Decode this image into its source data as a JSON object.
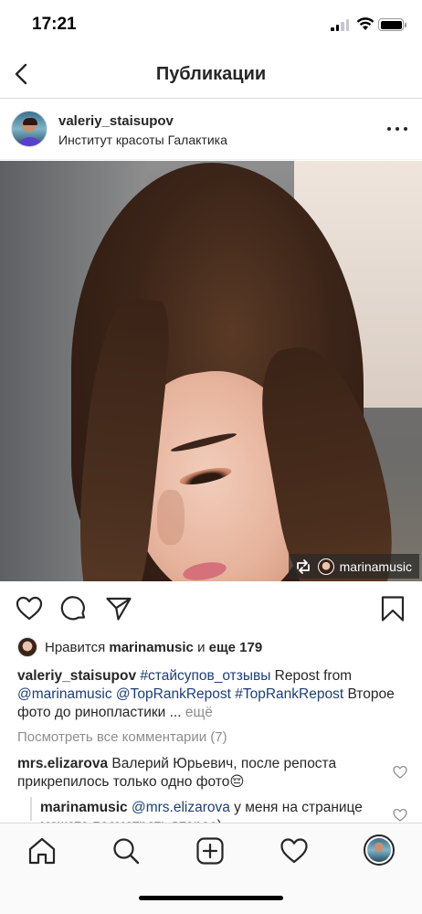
{
  "status_bar": {
    "time": "17:21"
  },
  "nav": {
    "title": "Публикации"
  },
  "post": {
    "username": "valeriy_staisupov",
    "location": "Институт красоты Галактика",
    "repost_user": "marinamusic",
    "likes": {
      "prefix": "Нравится ",
      "user": "marinamusic",
      "middle": " и ",
      "others": "еще 179"
    },
    "caption": {
      "username": "valeriy_staisupov",
      "hashtag": "#стайсупов_отзывы",
      "text_1": " Repost from ",
      "mention": "@marinamusic",
      "tag_2": "@TopRankRepost",
      "tag_3": "#TopRankRepost",
      "text_2": "Второе фото до ринопластики ... ",
      "more": "ещё"
    },
    "view_comments": "Посмотреть все комментарии (7)",
    "comments": [
      {
        "username": "mrs.elizarova",
        "text": " Валерий Юрьевич, после репоста прикрепилось только одно фото😔"
      },
      {
        "username": "marinamusic",
        "mention": "@mrs.elizarova",
        "text": " у меня на странице можете посмотреть второе)"
      }
    ]
  },
  "icons": {
    "back": "chevron-left-icon",
    "more": "ellipsis-icon",
    "like": "heart-icon",
    "comment": "comment-icon",
    "share": "paper-plane-icon",
    "save": "bookmark-icon",
    "repost": "repost-icon",
    "home": "home-icon",
    "search": "search-icon",
    "add": "add-post-icon",
    "activity": "heart-icon",
    "profile": "profile-avatar"
  }
}
